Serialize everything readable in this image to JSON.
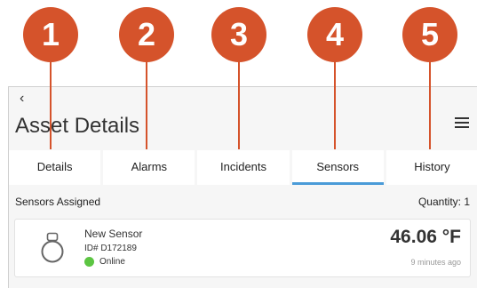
{
  "callouts": [
    "1",
    "2",
    "3",
    "4",
    "5"
  ],
  "header": {
    "back_icon": "chevron-left-icon",
    "title": "Asset Details",
    "menu_icon": "hamburger-menu-icon"
  },
  "tabs": [
    {
      "label": "Details",
      "active": false
    },
    {
      "label": "Alarms",
      "active": false
    },
    {
      "label": "Incidents",
      "active": false
    },
    {
      "label": "Sensors",
      "active": true
    },
    {
      "label": "History",
      "active": false
    }
  ],
  "section": {
    "title": "Sensors Assigned",
    "quantity": "Quantity: 1"
  },
  "sensor": {
    "icon": "sensor-ring-icon",
    "name": "New Sensor",
    "id": "ID# D172189",
    "status": "Online",
    "status_color": "#5cc542",
    "temperature": "46.06 °F",
    "updated": "9 minutes ago"
  },
  "colors": {
    "callout": "#d5532b",
    "active_tab": "#4a9bd8"
  }
}
